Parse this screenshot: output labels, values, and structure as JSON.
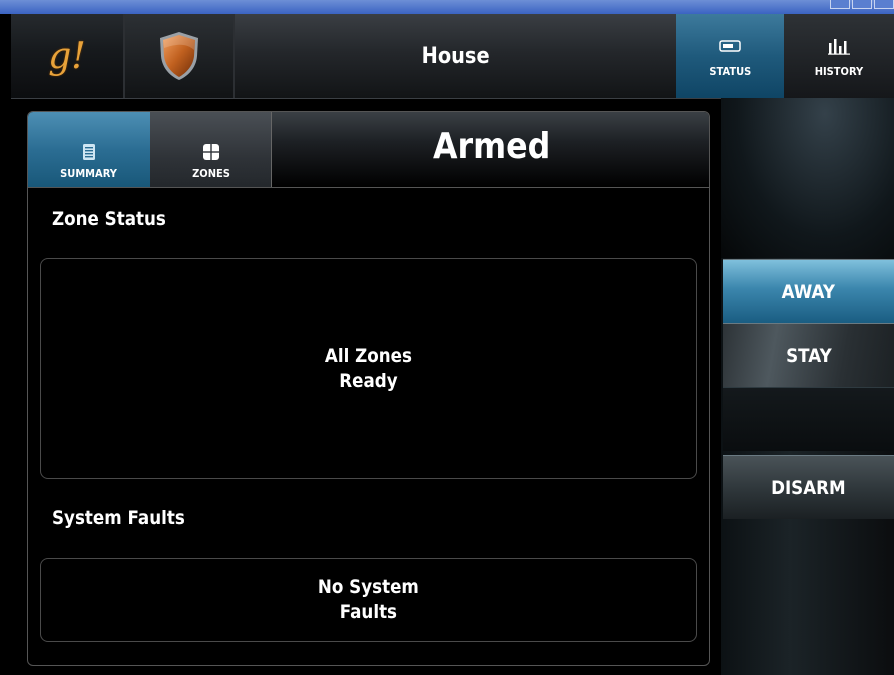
{
  "header": {
    "logo_text": "g!",
    "shield_icon": "shield-icon",
    "title": "House",
    "nav": [
      {
        "label": "STATUS",
        "icon": "status-icon",
        "active": true
      },
      {
        "label": "HISTORY",
        "icon": "history-chart-icon",
        "active": false
      }
    ]
  },
  "panel": {
    "tabs": [
      {
        "label": "SUMMARY",
        "icon": "summary-icon",
        "active": true
      },
      {
        "label": "ZONES",
        "icon": "zones-icon",
        "active": false
      }
    ],
    "state": "Armed",
    "zone_status_title": "Zone Status",
    "zone_status_lines": [
      "All Zones",
      "Ready"
    ],
    "system_faults_title": "System Faults",
    "system_faults_lines": [
      "No System",
      "Faults"
    ]
  },
  "modes": {
    "away_label": "AWAY",
    "stay_label": "STAY",
    "disarm_label": "DISARM"
  },
  "colors": {
    "accent_blue": "#2b6d93",
    "logo_orange": "#e8a23a",
    "shield_orange": "#c0601f"
  }
}
